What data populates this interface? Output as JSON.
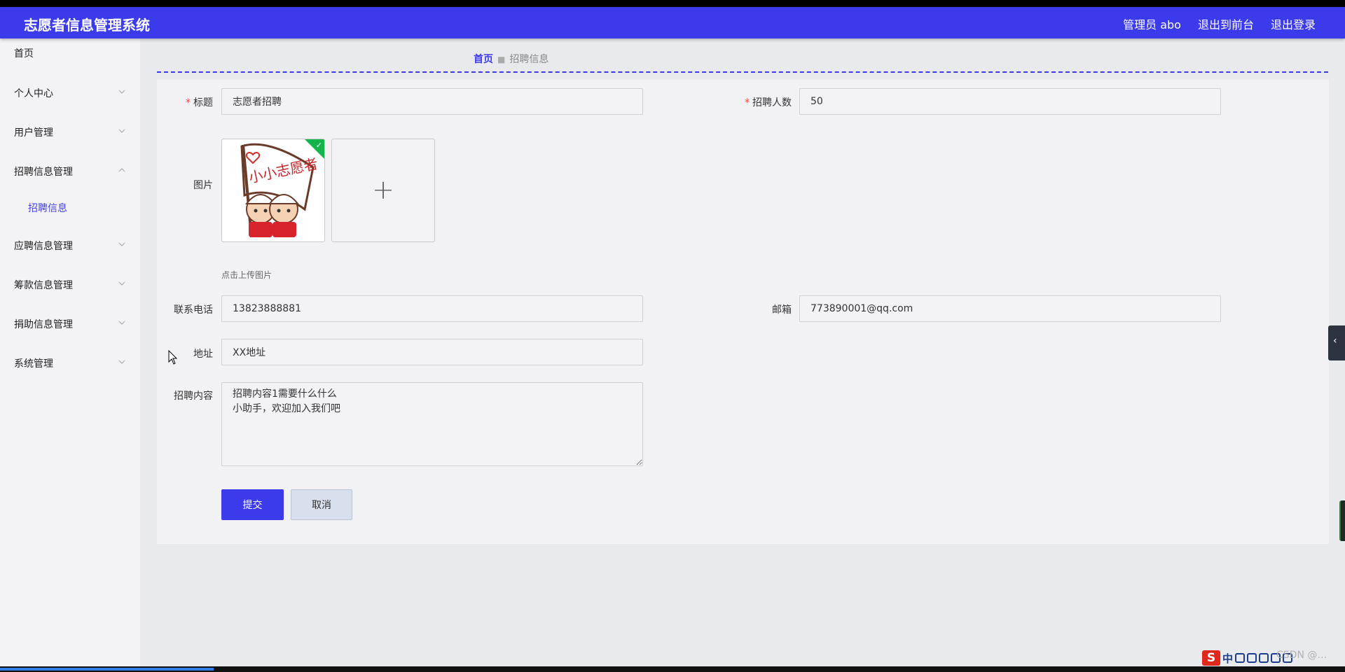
{
  "header": {
    "title": "志愿者信息管理系统",
    "admin_label": "管理员 abo",
    "front_label": "退出到前台",
    "logout_label": "退出登录",
    "bg_color": "#3b3bec"
  },
  "sidebar": {
    "items": [
      {
        "label": "首页"
      },
      {
        "label": "个人中心",
        "icon": "chevron-down-icon"
      },
      {
        "label": "用户管理",
        "icon": "chevron-down-icon"
      },
      {
        "label": "招聘信息管理",
        "icon": "chevron-up-icon"
      },
      {
        "label": "应聘信息管理",
        "icon": "chevron-down-icon"
      },
      {
        "label": "筹款信息管理",
        "icon": "chevron-down-icon"
      },
      {
        "label": "捐助信息管理",
        "icon": "chevron-down-icon"
      },
      {
        "label": "系统管理",
        "icon": "chevron-down-icon"
      }
    ],
    "subitem": {
      "label": "招聘信息"
    }
  },
  "breadcrumb": {
    "home": "首页",
    "current": "招聘信息"
  },
  "form": {
    "title": {
      "label": "标题",
      "value": "志愿者招聘"
    },
    "count": {
      "label": "招聘人数",
      "value": "50"
    },
    "image": {
      "label": "图片",
      "hint": "点击上传图片",
      "image_text": "小小志愿者"
    },
    "phone": {
      "label": "联系电话",
      "value": "13823888881"
    },
    "email": {
      "label": "邮箱",
      "value": "773890001@qq.com"
    },
    "address": {
      "label": "地址",
      "value": "XX地址"
    },
    "content": {
      "label": "招聘内容",
      "value": "招聘内容1需要什么什么\n小助手，欢迎加入我们吧"
    },
    "submit_label": "提交",
    "cancel_label": "取消"
  },
  "tray": {
    "text": "中"
  },
  "watermark": "CSDN @…"
}
